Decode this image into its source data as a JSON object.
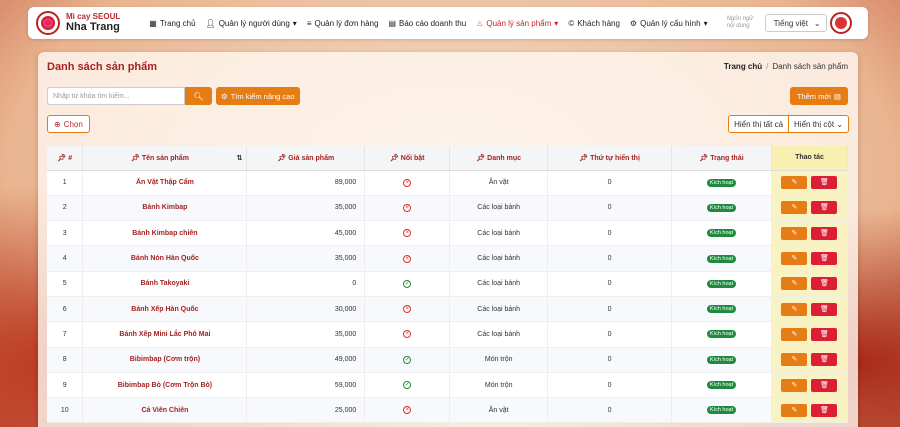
{
  "brand": {
    "line1": "Mì cay SEOUL",
    "line2": "Nha Trang"
  },
  "nav": [
    {
      "label": "Trang chủ",
      "icon": "grid-icon"
    },
    {
      "label": "Quản lý người dùng",
      "icon": "user-icon",
      "caret": "▾"
    },
    {
      "label": "Quản lý đơn hàng",
      "icon": "list-icon"
    },
    {
      "label": "Báo cáo doanh thu",
      "icon": "document-icon"
    },
    {
      "label": "Quản lý sản phẩm",
      "icon": "bowl-icon",
      "caret": "▾",
      "active": true
    },
    {
      "label": "Khách hàng",
      "icon": "copyright-icon"
    },
    {
      "label": "Quản lý cấu hình",
      "icon": "gear-icon",
      "caret": "▾"
    }
  ],
  "lang_hint": "Ngôn ngữ nội dung",
  "language": "Tiếng việt",
  "page_title": "Danh sách sản phẩm",
  "breadcrumb": {
    "home": "Trang chủ",
    "current": "Danh sách sản phẩm"
  },
  "search": {
    "placeholder": "Nhập từ khóa tìm kiếm..."
  },
  "buttons": {
    "advanced": "Tìm kiếm nâng cao",
    "add": "Thêm mới",
    "choose": "Chọn",
    "show_all": "Hiển thị tất cả",
    "show_cols": "Hiển thị cột"
  },
  "columns": [
    "#",
    "Tên sản phẩm",
    "Giá sản phẩm",
    "Nổi bật",
    "Danh mục",
    "Thứ tự hiển thị",
    "Trạng thái",
    "Thao tác"
  ],
  "rows": [
    {
      "no": "1",
      "name": "Ăn Vặt Thập Cẩm",
      "price": "89,000",
      "featured": false,
      "category": "Ăn vặt",
      "order": "0",
      "status": "Kích hoạt"
    },
    {
      "no": "2",
      "name": "Bánh Kimbap",
      "price": "35,000",
      "featured": false,
      "category": "Các loại bánh",
      "order": "0",
      "status": "Kích hoạt"
    },
    {
      "no": "3",
      "name": "Bánh Kimbap chiên",
      "price": "45,000",
      "featured": false,
      "category": "Các loại bánh",
      "order": "0",
      "status": "Kích hoạt"
    },
    {
      "no": "4",
      "name": "Bánh Nón Hàn Quốc",
      "price": "35,000",
      "featured": false,
      "category": "Các loại bánh",
      "order": "0",
      "status": "Kích hoạt"
    },
    {
      "no": "5",
      "name": "Bánh Takoyaki",
      "price": "0",
      "featured": true,
      "category": "Các loại bánh",
      "order": "0",
      "status": "Kích hoạt"
    },
    {
      "no": "6",
      "name": "Bánh Xếp Hàn Quốc",
      "price": "30,000",
      "featured": false,
      "category": "Các loại bánh",
      "order": "0",
      "status": "Kích hoạt"
    },
    {
      "no": "7",
      "name": "Bánh Xếp Mini Lắc Phô Mai",
      "price": "35,000",
      "featured": false,
      "category": "Các loại bánh",
      "order": "0",
      "status": "Kích hoạt"
    },
    {
      "no": "8",
      "name": "Bibimbap (Cơm trộn)",
      "price": "49,000",
      "featured": true,
      "category": "Món trộn",
      "order": "0",
      "status": "Kích hoạt"
    },
    {
      "no": "9",
      "name": "Bibimbap Bò (Cơm Trộn Bò)",
      "price": "59,000",
      "featured": true,
      "category": "Món trộn",
      "order": "0",
      "status": "Kích hoạt"
    },
    {
      "no": "10",
      "name": "Cá Viên Chiên",
      "price": "25,000",
      "featured": false,
      "category": "Ăn vặt",
      "order": "0",
      "status": "Kích hoạt"
    }
  ],
  "colors": {
    "accent": "#e57c14",
    "brand_red": "#c0282b",
    "success": "#1e8a3e",
    "danger": "#dc1f35"
  }
}
